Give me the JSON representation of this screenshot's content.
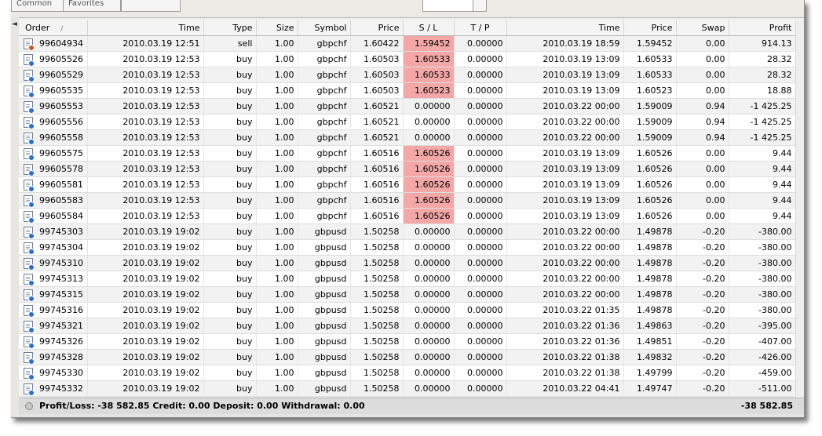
{
  "tabs": {
    "left1": "Common",
    "left2": "Favorites"
  },
  "columns": [
    "Order",
    "Time",
    "Type",
    "Size",
    "Symbol",
    "Price",
    "S / L",
    "T / P",
    "Time",
    "Price",
    "Swap",
    "Profit"
  ],
  "sort_indicator": "/",
  "rows": [
    {
      "order": "99604934",
      "open_time": "2010.03.19 12:51",
      "type": "sell",
      "size": "1.00",
      "symbol": "gbpchf",
      "open_price": "1.60422",
      "sl": "1.59452",
      "sl_hit": true,
      "tp": "0.00000",
      "close_time": "2010.03.19 18:59",
      "close_price": "1.59452",
      "swap": "0.00",
      "profit": "914.13"
    },
    {
      "order": "99605526",
      "open_time": "2010.03.19 12:53",
      "type": "buy",
      "size": "1.00",
      "symbol": "gbpchf",
      "open_price": "1.60503",
      "sl": "1.60533",
      "sl_hit": true,
      "tp": "0.00000",
      "close_time": "2010.03.19 13:09",
      "close_price": "1.60533",
      "swap": "0.00",
      "profit": "28.32"
    },
    {
      "order": "99605529",
      "open_time": "2010.03.19 12:53",
      "type": "buy",
      "size": "1.00",
      "symbol": "gbpchf",
      "open_price": "1.60503",
      "sl": "1.60533",
      "sl_hit": true,
      "tp": "0.00000",
      "close_time": "2010.03.19 13:09",
      "close_price": "1.60533",
      "swap": "0.00",
      "profit": "28.32"
    },
    {
      "order": "99605535",
      "open_time": "2010.03.19 12:53",
      "type": "buy",
      "size": "1.00",
      "symbol": "gbpchf",
      "open_price": "1.60503",
      "sl": "1.60523",
      "sl_hit": true,
      "tp": "0.00000",
      "close_time": "2010.03.19 13:09",
      "close_price": "1.60523",
      "swap": "0.00",
      "profit": "18.88"
    },
    {
      "order": "99605553",
      "open_time": "2010.03.19 12:53",
      "type": "buy",
      "size": "1.00",
      "symbol": "gbpchf",
      "open_price": "1.60521",
      "sl": "0.00000",
      "sl_hit": false,
      "tp": "0.00000",
      "close_time": "2010.03.22 00:00",
      "close_price": "1.59009",
      "swap": "0.94",
      "profit": "-1 425.25"
    },
    {
      "order": "99605556",
      "open_time": "2010.03.19 12:53",
      "type": "buy",
      "size": "1.00",
      "symbol": "gbpchf",
      "open_price": "1.60521",
      "sl": "0.00000",
      "sl_hit": false,
      "tp": "0.00000",
      "close_time": "2010.03.22 00:00",
      "close_price": "1.59009",
      "swap": "0.94",
      "profit": "-1 425.25"
    },
    {
      "order": "99605558",
      "open_time": "2010.03.19 12:53",
      "type": "buy",
      "size": "1.00",
      "symbol": "gbpchf",
      "open_price": "1.60521",
      "sl": "0.00000",
      "sl_hit": false,
      "tp": "0.00000",
      "close_time": "2010.03.22 00:00",
      "close_price": "1.59009",
      "swap": "0.94",
      "profit": "-1 425.25"
    },
    {
      "order": "99605575",
      "open_time": "2010.03.19 12:53",
      "type": "buy",
      "size": "1.00",
      "symbol": "gbpchf",
      "open_price": "1.60516",
      "sl": "1.60526",
      "sl_hit": true,
      "tp": "0.00000",
      "close_time": "2010.03.19 13:09",
      "close_price": "1.60526",
      "swap": "0.00",
      "profit": "9.44"
    },
    {
      "order": "99605578",
      "open_time": "2010.03.19 12:53",
      "type": "buy",
      "size": "1.00",
      "symbol": "gbpchf",
      "open_price": "1.60516",
      "sl": "1.60526",
      "sl_hit": true,
      "tp": "0.00000",
      "close_time": "2010.03.19 13:09",
      "close_price": "1.60526",
      "swap": "0.00",
      "profit": "9.44"
    },
    {
      "order": "99605581",
      "open_time": "2010.03.19 12:53",
      "type": "buy",
      "size": "1.00",
      "symbol": "gbpchf",
      "open_price": "1.60516",
      "sl": "1.60526",
      "sl_hit": true,
      "tp": "0.00000",
      "close_time": "2010.03.19 13:09",
      "close_price": "1.60526",
      "swap": "0.00",
      "profit": "9.44"
    },
    {
      "order": "99605583",
      "open_time": "2010.03.19 12:53",
      "type": "buy",
      "size": "1.00",
      "symbol": "gbpchf",
      "open_price": "1.60516",
      "sl": "1.60526",
      "sl_hit": true,
      "tp": "0.00000",
      "close_time": "2010.03.19 13:09",
      "close_price": "1.60526",
      "swap": "0.00",
      "profit": "9.44"
    },
    {
      "order": "99605584",
      "open_time": "2010.03.19 12:53",
      "type": "buy",
      "size": "1.00",
      "symbol": "gbpchf",
      "open_price": "1.60516",
      "sl": "1.60526",
      "sl_hit": true,
      "tp": "0.00000",
      "close_time": "2010.03.19 13:09",
      "close_price": "1.60526",
      "swap": "0.00",
      "profit": "9.44"
    },
    {
      "order": "99745303",
      "open_time": "2010.03.19 19:02",
      "type": "buy",
      "size": "1.00",
      "symbol": "gbpusd",
      "open_price": "1.50258",
      "sl": "0.00000",
      "sl_hit": false,
      "tp": "0.00000",
      "close_time": "2010.03.22 00:00",
      "close_price": "1.49878",
      "swap": "-0.20",
      "profit": "-380.00"
    },
    {
      "order": "99745304",
      "open_time": "2010.03.19 19:02",
      "type": "buy",
      "size": "1.00",
      "symbol": "gbpusd",
      "open_price": "1.50258",
      "sl": "0.00000",
      "sl_hit": false,
      "tp": "0.00000",
      "close_time": "2010.03.22 00:00",
      "close_price": "1.49878",
      "swap": "-0.20",
      "profit": "-380.00"
    },
    {
      "order": "99745310",
      "open_time": "2010.03.19 19:02",
      "type": "buy",
      "size": "1.00",
      "symbol": "gbpusd",
      "open_price": "1.50258",
      "sl": "0.00000",
      "sl_hit": false,
      "tp": "0.00000",
      "close_time": "2010.03.22 00:00",
      "close_price": "1.49878",
      "swap": "-0.20",
      "profit": "-380.00"
    },
    {
      "order": "99745313",
      "open_time": "2010.03.19 19:02",
      "type": "buy",
      "size": "1.00",
      "symbol": "gbpusd",
      "open_price": "1.50258",
      "sl": "0.00000",
      "sl_hit": false,
      "tp": "0.00000",
      "close_time": "2010.03.22 00:00",
      "close_price": "1.49878",
      "swap": "-0.20",
      "profit": "-380.00"
    },
    {
      "order": "99745315",
      "open_time": "2010.03.19 19:02",
      "type": "buy",
      "size": "1.00",
      "symbol": "gbpusd",
      "open_price": "1.50258",
      "sl": "0.00000",
      "sl_hit": false,
      "tp": "0.00000",
      "close_time": "2010.03.22 00:00",
      "close_price": "1.49878",
      "swap": "-0.20",
      "profit": "-380.00"
    },
    {
      "order": "99745316",
      "open_time": "2010.03.19 19:02",
      "type": "buy",
      "size": "1.00",
      "symbol": "gbpusd",
      "open_price": "1.50258",
      "sl": "0.00000",
      "sl_hit": false,
      "tp": "0.00000",
      "close_time": "2010.03.22 01:35",
      "close_price": "1.49878",
      "swap": "-0.20",
      "profit": "-380.00"
    },
    {
      "order": "99745321",
      "open_time": "2010.03.19 19:02",
      "type": "buy",
      "size": "1.00",
      "symbol": "gbpusd",
      "open_price": "1.50258",
      "sl": "0.00000",
      "sl_hit": false,
      "tp": "0.00000",
      "close_time": "2010.03.22 01:36",
      "close_price": "1.49863",
      "swap": "-0.20",
      "profit": "-395.00"
    },
    {
      "order": "99745326",
      "open_time": "2010.03.19 19:02",
      "type": "buy",
      "size": "1.00",
      "symbol": "gbpusd",
      "open_price": "1.50258",
      "sl": "0.00000",
      "sl_hit": false,
      "tp": "0.00000",
      "close_time": "2010.03.22 01:36",
      "close_price": "1.49851",
      "swap": "-0.20",
      "profit": "-407.00"
    },
    {
      "order": "99745328",
      "open_time": "2010.03.19 19:02",
      "type": "buy",
      "size": "1.00",
      "symbol": "gbpusd",
      "open_price": "1.50258",
      "sl": "0.00000",
      "sl_hit": false,
      "tp": "0.00000",
      "close_time": "2010.03.22 01:38",
      "close_price": "1.49832",
      "swap": "-0.20",
      "profit": "-426.00"
    },
    {
      "order": "99745330",
      "open_time": "2010.03.19 19:02",
      "type": "buy",
      "size": "1.00",
      "symbol": "gbpusd",
      "open_price": "1.50258",
      "sl": "0.00000",
      "sl_hit": false,
      "tp": "0.00000",
      "close_time": "2010.03.22 01:38",
      "close_price": "1.49799",
      "swap": "-0.20",
      "profit": "-459.00"
    },
    {
      "order": "99745332",
      "open_time": "2010.03.19 19:02",
      "type": "buy",
      "size": "1.00",
      "symbol": "gbpusd",
      "open_price": "1.50258",
      "sl": "0.00000",
      "sl_hit": false,
      "tp": "0.00000",
      "close_time": "2010.03.22 04:41",
      "close_price": "1.49747",
      "swap": "-0.20",
      "profit": "-511.00"
    }
  ],
  "status": {
    "summary": "Profit/Loss: -38 582.85  Credit: 0.00  Deposit: 0.00  Withdrawal: 0.00",
    "total": "-38 582.85"
  },
  "colors": {
    "sl_highlight": "#f4a7a7",
    "buy_dot": "#2b6fd0",
    "sell_dot": "#d2561c"
  },
  "icons": {
    "row": "document-icon",
    "status": "circle-status-icon",
    "scroll_left": "chevron-left-icon"
  }
}
